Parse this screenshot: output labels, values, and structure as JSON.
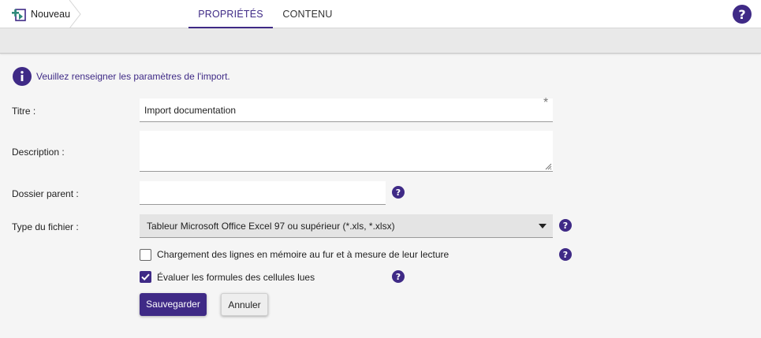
{
  "breadcrumb": {
    "label": "Nouveau",
    "icon": "new-document-icon"
  },
  "tabs": [
    {
      "label": "PROPRIÉTÉS",
      "active": true
    },
    {
      "label": "CONTENU",
      "active": false
    }
  ],
  "header": {
    "help_icon": "help-icon"
  },
  "info": {
    "icon": "info-icon",
    "text": "Veuillez renseigner les paramètres de l'import."
  },
  "form": {
    "title": {
      "label": "Titre :",
      "value": "Import documentation",
      "required_mark": "*"
    },
    "description": {
      "label": "Description :",
      "value": ""
    },
    "parent_folder": {
      "label": "Dossier parent :",
      "value": ""
    },
    "file_type": {
      "label": "Type du fichier :",
      "selected": "Tableur Microsoft Office Excel 97 ou supérieur (*.xls, *.xlsx)"
    },
    "stream_loading": {
      "label": "Chargement des lignes en mémoire au fur et à mesure de leur lecture",
      "checked": false
    },
    "evaluate_formulas": {
      "label": "Évaluer les formules des cellules lues",
      "checked": true
    }
  },
  "buttons": {
    "save": "Sauvegarder",
    "cancel": "Annuler"
  },
  "colors": {
    "accent": "#3f2a86",
    "band": "#e9e9e9",
    "select_bg": "#e4e4e4"
  }
}
